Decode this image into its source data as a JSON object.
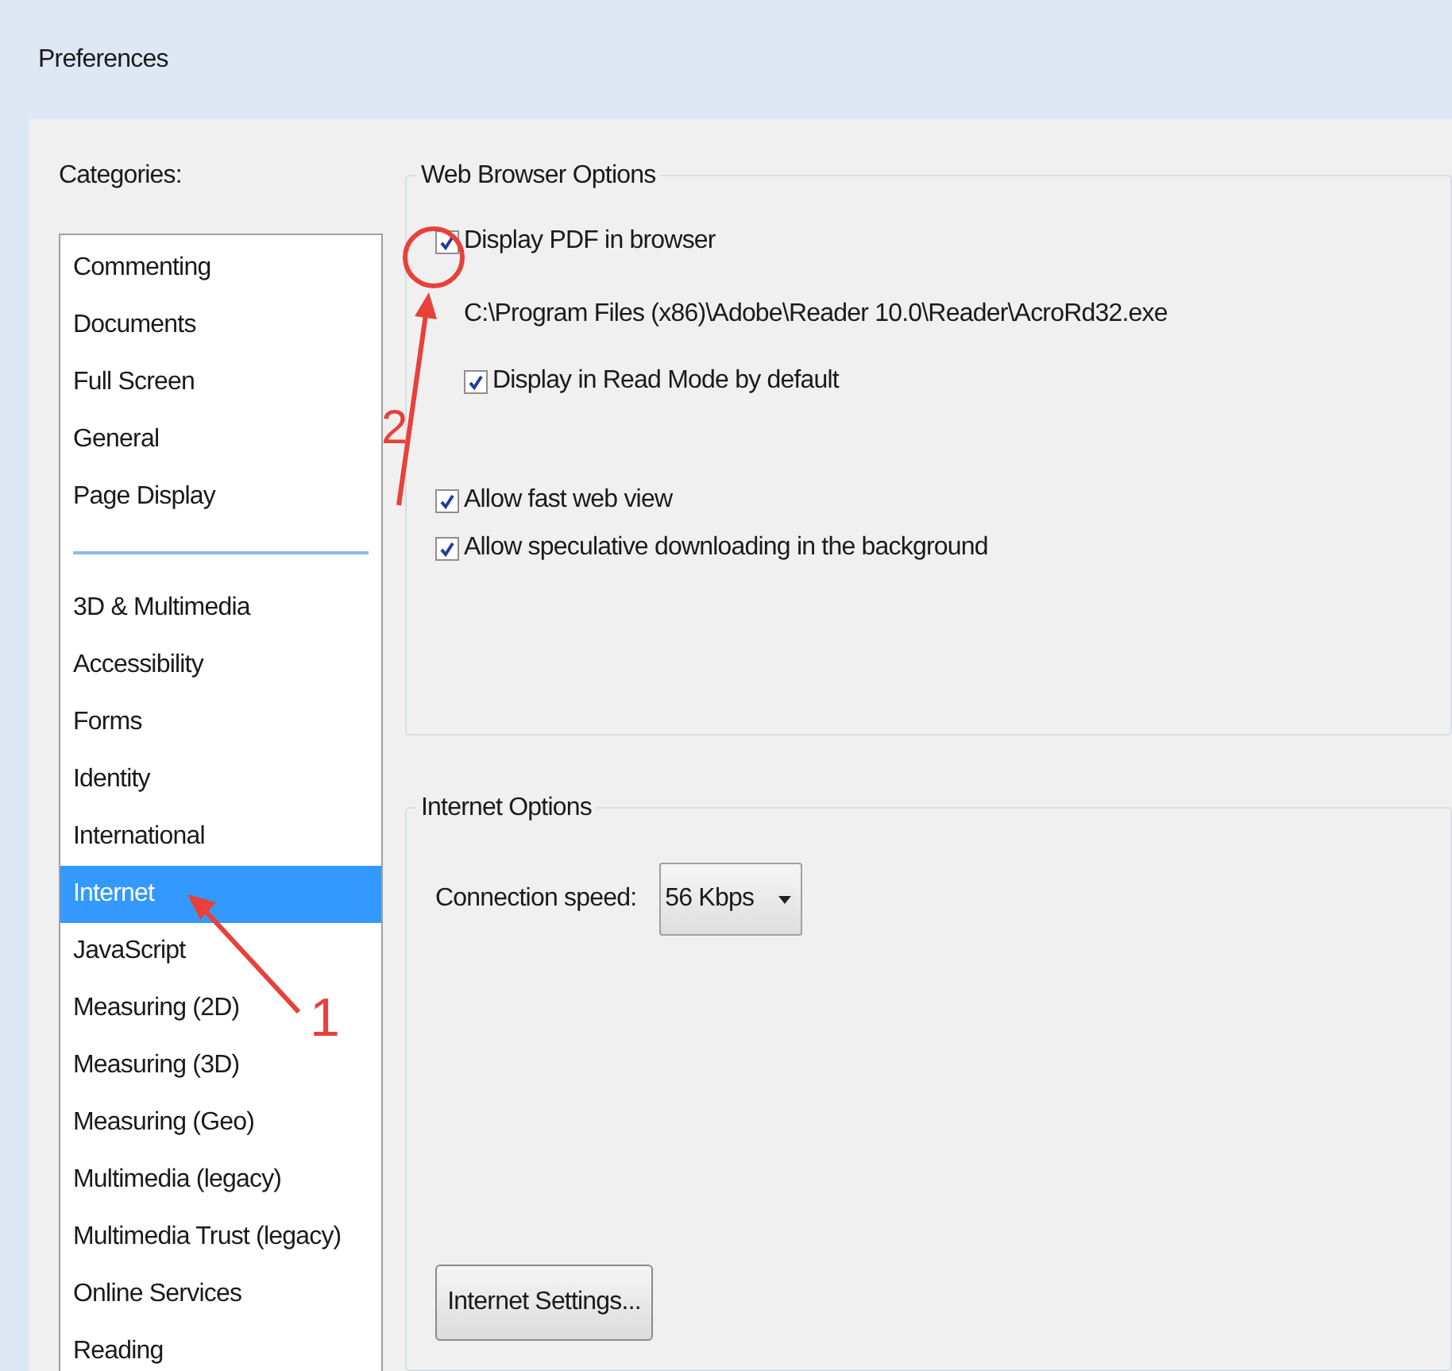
{
  "window": {
    "title": "Preferences"
  },
  "categories": {
    "label": "Categories:",
    "groups": [
      {
        "items": [
          {
            "label": "Commenting",
            "selected": false
          },
          {
            "label": "Documents",
            "selected": false
          },
          {
            "label": "Full Screen",
            "selected": false
          },
          {
            "label": "General",
            "selected": false
          },
          {
            "label": "Page Display",
            "selected": false
          }
        ]
      },
      {
        "items": [
          {
            "label": "3D & Multimedia",
            "selected": false
          },
          {
            "label": "Accessibility",
            "selected": false
          },
          {
            "label": "Forms",
            "selected": false
          },
          {
            "label": "Identity",
            "selected": false
          },
          {
            "label": "International",
            "selected": false
          },
          {
            "label": "Internet",
            "selected": true
          },
          {
            "label": "JavaScript",
            "selected": false
          },
          {
            "label": "Measuring (2D)",
            "selected": false
          },
          {
            "label": "Measuring (3D)",
            "selected": false
          },
          {
            "label": "Measuring (Geo)",
            "selected": false
          },
          {
            "label": "Multimedia (legacy)",
            "selected": false
          },
          {
            "label": "Multimedia Trust (legacy)",
            "selected": false
          },
          {
            "label": "Online Services",
            "selected": false
          },
          {
            "label": "Reading",
            "selected": false
          }
        ]
      }
    ]
  },
  "web_browser_options": {
    "title": "Web Browser Options",
    "items": [
      {
        "kind": "checkbox",
        "label": "Display PDF in browser",
        "checked": true,
        "children": [
          {
            "kind": "text",
            "text": "C:\\Program Files (x86)\\Adobe\\Reader 10.0\\Reader\\AcroRd32.exe"
          },
          {
            "kind": "checkbox",
            "label": "Display in Read Mode by default",
            "checked": true
          }
        ]
      },
      {
        "kind": "spacer"
      },
      {
        "kind": "checkbox",
        "label": "Allow fast web view",
        "checked": true
      },
      {
        "kind": "checkbox",
        "label": "Allow speculative downloading in the background",
        "checked": true
      }
    ]
  },
  "internet_options": {
    "title": "Internet Options",
    "connection_speed": {
      "label": "Connection speed:",
      "value": "56 Kbps"
    },
    "button": "Internet Settings..."
  },
  "annotations": [
    {
      "label": "1"
    },
    {
      "label": "2"
    }
  ]
}
